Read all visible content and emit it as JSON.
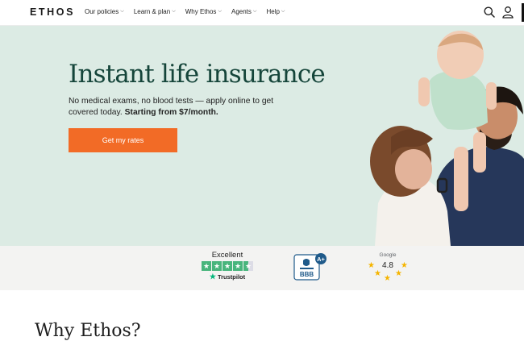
{
  "brand": "ETHOS",
  "nav": {
    "items": [
      "Our policies",
      "Learn & plan",
      "Why Ethos",
      "Agents",
      "Help"
    ]
  },
  "hero": {
    "title": "Instant life insurance",
    "subtitle": "No medical exams, no blood tests — apply online to get covered today.",
    "subtitle_bold": "Starting from $7/month.",
    "cta": "Get my rates"
  },
  "ratings": {
    "trustpilot": {
      "label": "Excellent",
      "brand": "Trustpilot",
      "stars": 4.5
    },
    "bbb": {
      "grade": "A+",
      "text": "BBB"
    },
    "google": {
      "brand": "Google",
      "rating": "4.8"
    }
  },
  "section": {
    "heading": "Why Ethos?"
  },
  "colors": {
    "hero_bg": "#dcebe4",
    "title": "#15453a",
    "cta": "#f26b26",
    "trustpilot": "#48b57c",
    "bbb": "#1f5a8a",
    "google_star": "#f5b400"
  }
}
